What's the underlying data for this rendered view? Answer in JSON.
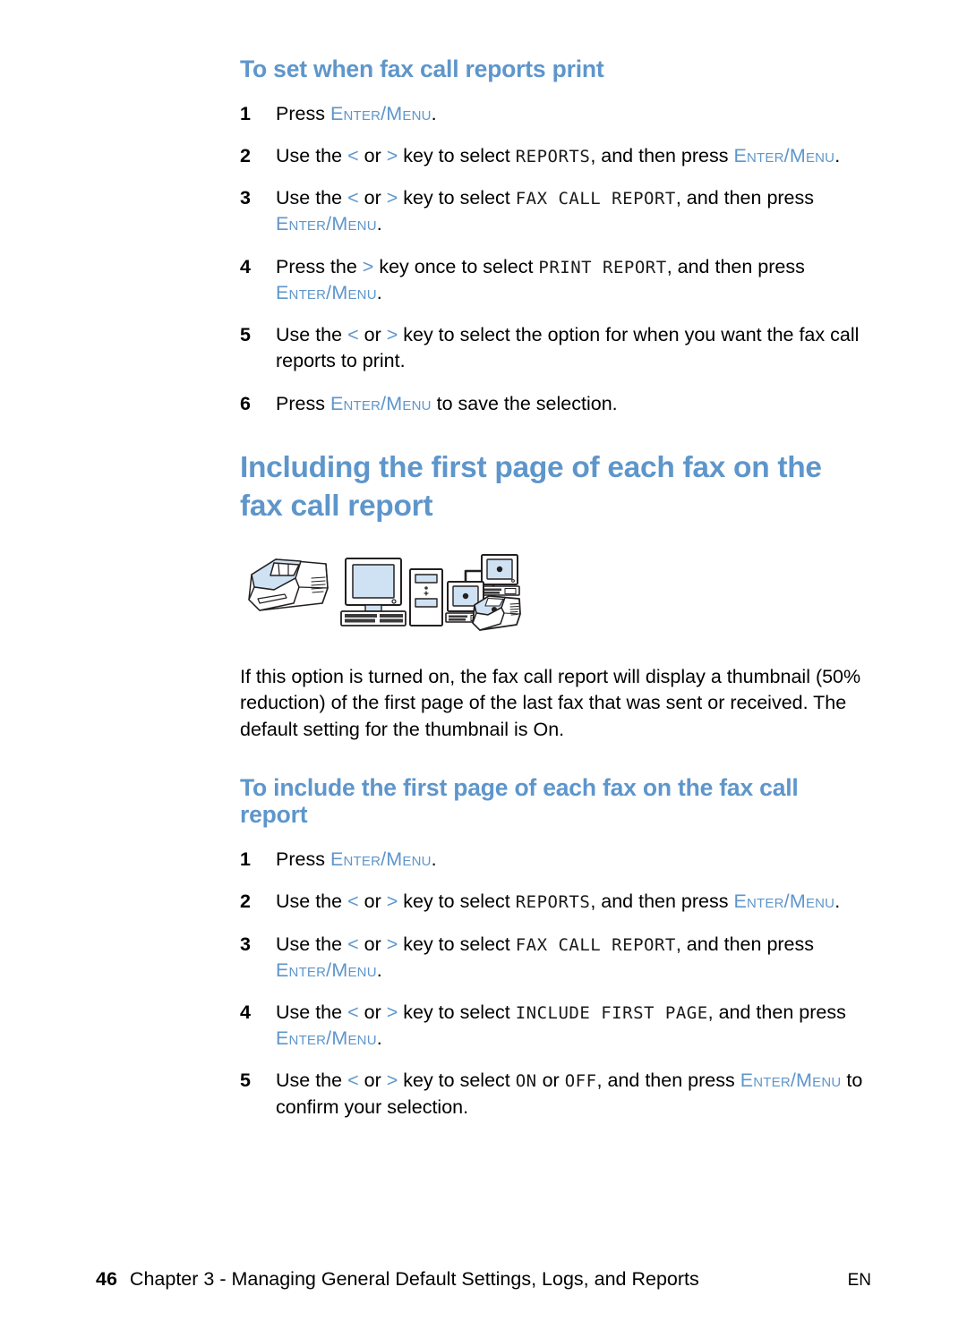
{
  "document": {
    "section_1": {
      "heading": "To set when fax call reports print",
      "steps": [
        {
          "num": "1",
          "parts": [
            {
              "t": "text",
              "v": "Press "
            },
            {
              "t": "keycap",
              "v": "Enter/Menu"
            },
            {
              "t": "text",
              "v": "."
            }
          ]
        },
        {
          "num": "2",
          "parts": [
            {
              "t": "text",
              "v": "Use the "
            },
            {
              "t": "arrow",
              "v": "<"
            },
            {
              "t": "text",
              "v": " or "
            },
            {
              "t": "arrow",
              "v": ">"
            },
            {
              "t": "text",
              "v": " key to select "
            },
            {
              "t": "lcd",
              "v": "REPORTS"
            },
            {
              "t": "text",
              "v": ", and then press "
            },
            {
              "t": "keycap",
              "v": "Enter/Menu"
            },
            {
              "t": "text",
              "v": "."
            }
          ]
        },
        {
          "num": "3",
          "parts": [
            {
              "t": "text",
              "v": "Use the "
            },
            {
              "t": "arrow",
              "v": "<"
            },
            {
              "t": "text",
              "v": " or "
            },
            {
              "t": "arrow",
              "v": ">"
            },
            {
              "t": "text",
              "v": " key to select "
            },
            {
              "t": "lcd",
              "v": "FAX CALL REPORT"
            },
            {
              "t": "text",
              "v": ", and then press "
            },
            {
              "t": "keycap",
              "v": "Enter/Menu"
            },
            {
              "t": "text",
              "v": "."
            }
          ]
        },
        {
          "num": "4",
          "parts": [
            {
              "t": "text",
              "v": "Press the "
            },
            {
              "t": "arrow",
              "v": ">"
            },
            {
              "t": "text",
              "v": " key once to select "
            },
            {
              "t": "lcd",
              "v": "PRINT REPORT"
            },
            {
              "t": "text",
              "v": ", and then press "
            },
            {
              "t": "keycap",
              "v": "Enter/Menu"
            },
            {
              "t": "text",
              "v": "."
            }
          ]
        },
        {
          "num": "5",
          "parts": [
            {
              "t": "text",
              "v": "Use the "
            },
            {
              "t": "arrow",
              "v": "<"
            },
            {
              "t": "text",
              "v": " or "
            },
            {
              "t": "arrow",
              "v": ">"
            },
            {
              "t": "text",
              "v": " key to select the option for when you want the fax call reports to print."
            }
          ]
        },
        {
          "num": "6",
          "parts": [
            {
              "t": "text",
              "v": "Press "
            },
            {
              "t": "keycap",
              "v": "Enter/Menu"
            },
            {
              "t": "text",
              "v": " to save the selection."
            }
          ]
        }
      ]
    },
    "section_2": {
      "heading": "Including the first page of each fax on the fax call report",
      "figure_alt": "printer-computer-network-illustration",
      "paragraph": "If this option is turned on, the fax call report will display a thumbnail (50% reduction) of the first page of the last fax that was sent or received. The default setting for the thumbnail is On.",
      "sub_heading": "To include the first page of each fax on the fax call report",
      "steps": [
        {
          "num": "1",
          "parts": [
            {
              "t": "text",
              "v": "Press "
            },
            {
              "t": "keycap",
              "v": "Enter/Menu"
            },
            {
              "t": "text",
              "v": "."
            }
          ]
        },
        {
          "num": "2",
          "parts": [
            {
              "t": "text",
              "v": "Use the "
            },
            {
              "t": "arrow",
              "v": "<"
            },
            {
              "t": "text",
              "v": " or "
            },
            {
              "t": "arrow",
              "v": ">"
            },
            {
              "t": "text",
              "v": " key to select "
            },
            {
              "t": "lcd",
              "v": "REPORTS"
            },
            {
              "t": "text",
              "v": ", and then press "
            },
            {
              "t": "keycap",
              "v": "Enter/Menu"
            },
            {
              "t": "text",
              "v": "."
            }
          ]
        },
        {
          "num": "3",
          "parts": [
            {
              "t": "text",
              "v": "Use the "
            },
            {
              "t": "arrow",
              "v": "<"
            },
            {
              "t": "text",
              "v": " or "
            },
            {
              "t": "arrow",
              "v": ">"
            },
            {
              "t": "text",
              "v": " key to select "
            },
            {
              "t": "lcd",
              "v": "FAX CALL REPORT"
            },
            {
              "t": "text",
              "v": ", and then press "
            },
            {
              "t": "keycap",
              "v": "Enter/Menu"
            },
            {
              "t": "text",
              "v": "."
            }
          ]
        },
        {
          "num": "4",
          "parts": [
            {
              "t": "text",
              "v": "Use the "
            },
            {
              "t": "arrow",
              "v": "<"
            },
            {
              "t": "text",
              "v": " or "
            },
            {
              "t": "arrow",
              "v": ">"
            },
            {
              "t": "text",
              "v": " key to select "
            },
            {
              "t": "lcd",
              "v": "INCLUDE FIRST PAGE"
            },
            {
              "t": "text",
              "v": ", and then press "
            },
            {
              "t": "keycap",
              "v": "Enter/Menu"
            },
            {
              "t": "text",
              "v": "."
            }
          ]
        },
        {
          "num": "5",
          "parts": [
            {
              "t": "text",
              "v": "Use the "
            },
            {
              "t": "arrow",
              "v": "<"
            },
            {
              "t": "text",
              "v": " or "
            },
            {
              "t": "arrow",
              "v": ">"
            },
            {
              "t": "text",
              "v": " key to select "
            },
            {
              "t": "lcd",
              "v": "ON"
            },
            {
              "t": "text",
              "v": " or "
            },
            {
              "t": "lcd",
              "v": "OFF"
            },
            {
              "t": "text",
              "v": ", and then press "
            },
            {
              "t": "keycap",
              "v": "Enter/Menu"
            },
            {
              "t": "text",
              "v": " to confirm your selection."
            }
          ]
        }
      ]
    },
    "footer": {
      "page_number": "46",
      "title": "Chapter 3 - Managing General Default Settings, Logs, and Reports",
      "language": "EN"
    },
    "colors": {
      "heading_blue": "#5e96cb",
      "keycap_blue": "#5e96cb",
      "body_black": "#000000",
      "figure_fill_blue": "#cfe2f3",
      "figure_outline": "#231f20"
    }
  }
}
